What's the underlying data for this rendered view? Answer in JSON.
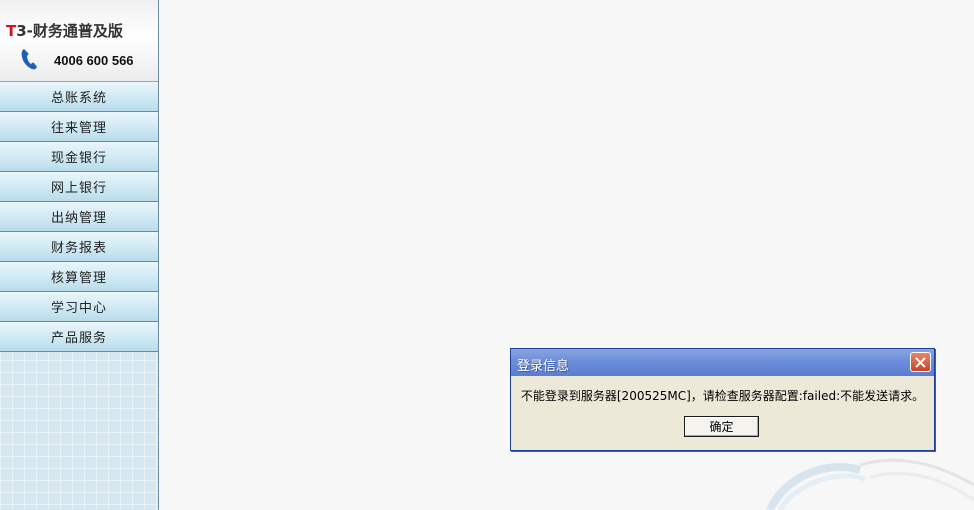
{
  "sidebar": {
    "brand": {
      "product_prefix": "T",
      "product_rest": "3-财务通普及版",
      "hotline": "4006 600 566",
      "phone_icon": "phone-icon"
    },
    "nav_items": [
      {
        "label": "总账系统"
      },
      {
        "label": "往来管理"
      },
      {
        "label": "现金银行"
      },
      {
        "label": "网上银行"
      },
      {
        "label": "出纳管理"
      },
      {
        "label": "财务报表"
      },
      {
        "label": "核算管理"
      },
      {
        "label": "学习中心"
      },
      {
        "label": "产品服务"
      }
    ]
  },
  "dialog": {
    "title": "登录信息",
    "message": "不能登录到服务器[200525MC]，请检查服务器配置:failed:不能发送请求。",
    "ok_label": "确定",
    "close_icon": "close-icon"
  },
  "colors": {
    "brand_red": "#d4141b",
    "titlebar_blue": "#6f8fda",
    "dialog_face": "#ece9d8",
    "close_red": "#c8452a"
  }
}
